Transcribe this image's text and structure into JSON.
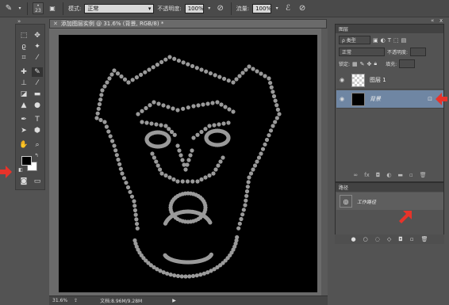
{
  "options_bar": {
    "brush_size": "23",
    "mode_label": "模式:",
    "mode_value": "正常",
    "opacity_label": "不透明度:",
    "opacity_value": "100%",
    "flow_label": "流量:",
    "flow_value": "100%"
  },
  "document": {
    "title": "添加图层实例 @ 31.6% (背景, RGB/8) *",
    "zoom": "31.6%",
    "doc_size": "文档:8.96M/9.28M"
  },
  "layers_panel": {
    "tab_label": "图层",
    "filter_kind": "ρ 类型",
    "blend_mode": "正常",
    "opacity_label": "不透明度:",
    "lock_label": "锁定:",
    "fill_label": "填充:",
    "layers": [
      {
        "name": "图层 1",
        "thumb": "transparent"
      },
      {
        "name": "背景",
        "thumb": "black",
        "selected": true
      }
    ]
  },
  "paths_panel": {
    "tab_label": "路径",
    "paths": [
      {
        "name": "工作路径"
      }
    ]
  },
  "colors": {
    "accent_arrow": "#e8332a",
    "selected_layer": "#6f86a3"
  }
}
